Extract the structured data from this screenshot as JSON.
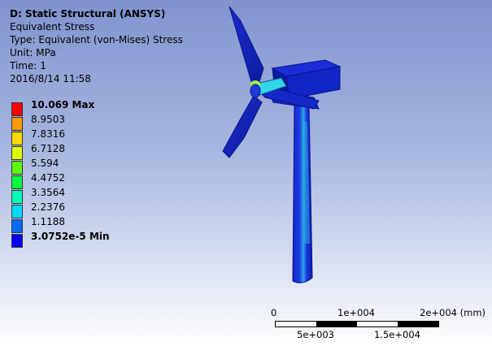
{
  "header": {
    "title": "D: Static Structural (ANSYS)",
    "result_name": "Equivalent Stress",
    "type_line": "Type: Equivalent (von-Mises) Stress",
    "unit_line": "Unit: MPa",
    "time_line": "Time: 1",
    "timestamp": "2016/8/14 11:58"
  },
  "legend": {
    "entries": [
      {
        "label": "10.069 Max",
        "color": "#ff0000",
        "bold": true
      },
      {
        "label": "8.9503",
        "color": "#ff9900",
        "bold": false
      },
      {
        "label": "7.8316",
        "color": "#ffd800",
        "bold": false
      },
      {
        "label": "6.7128",
        "color": "#d9ff00",
        "bold": false
      },
      {
        "label": "5.594",
        "color": "#5cff00",
        "bold": false
      },
      {
        "label": "4.4752",
        "color": "#00ff3c",
        "bold": false
      },
      {
        "label": "3.3564",
        "color": "#00ffb6",
        "bold": false
      },
      {
        "label": "2.2376",
        "color": "#00d8ff",
        "bold": false
      },
      {
        "label": "1.1188",
        "color": "#006cff",
        "bold": false
      },
      {
        "label": "3.0752e-5 Min",
        "color": "#0000ff",
        "bold": true
      }
    ]
  },
  "scale": {
    "top_labels": [
      "0",
      "1e+004",
      "2e+004 (mm)"
    ],
    "bottom_labels": [
      "5e+003",
      "1.5e+004"
    ]
  },
  "colors": {
    "model_blue": "#1c2fd9",
    "model_dark_blue": "#0a1a9a",
    "hub_cyan": "#33d6e8",
    "hub_green": "#9cf04a"
  }
}
